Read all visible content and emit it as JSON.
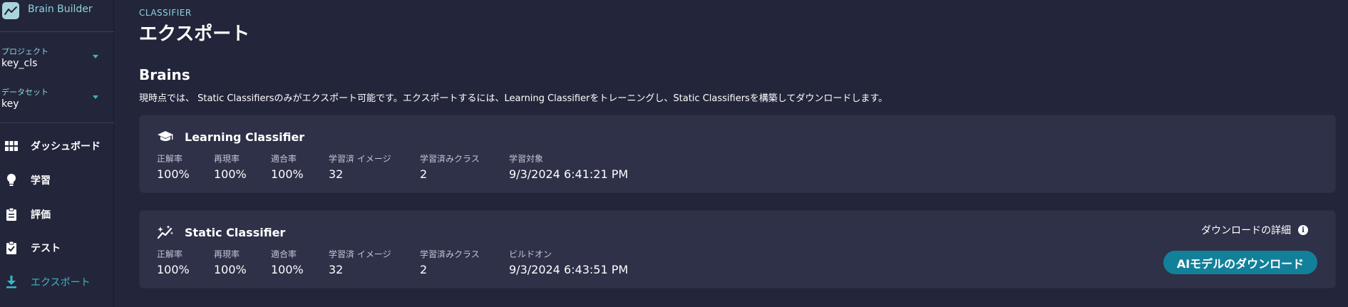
{
  "app": {
    "brand_name": "Brain Builder",
    "brand_icon": "trend-line-icon"
  },
  "sidebar": {
    "project": {
      "label": "プロジェクト",
      "value": "key_cls"
    },
    "dataset": {
      "label": "データセット",
      "value": "key"
    },
    "items": [
      {
        "label": "ダッシュボード",
        "icon": "grid-icon",
        "active": false
      },
      {
        "label": "学習",
        "icon": "lightbulb-icon",
        "active": false
      },
      {
        "label": "評価",
        "icon": "clipboard-icon",
        "active": false
      },
      {
        "label": "テスト",
        "icon": "clipboard-check-icon",
        "active": false
      },
      {
        "label": "エクスポート",
        "icon": "download-icon",
        "active": true
      }
    ]
  },
  "header": {
    "eyebrow": "CLASSIFIER",
    "title": "エクスポート"
  },
  "brains": {
    "title": "Brains",
    "description": "現時点では、 Static Classifiersのみがエクスポート可能です。エクスポートするには、Learning Classifierをトレーニングし、Static Classifiersを構築してダウンロードします。",
    "learning": {
      "title": "Learning Classifier",
      "icon": "graduation-cap-icon",
      "metrics": [
        {
          "label": "正解率",
          "value": "100%"
        },
        {
          "label": "再現率",
          "value": "100%"
        },
        {
          "label": "適合率",
          "value": "100%"
        },
        {
          "label": "学習済 イメージ",
          "value": "32"
        },
        {
          "label": "学習済みクラス",
          "value": "2"
        },
        {
          "label": "学習対象",
          "value": "9/3/2024 6:41:21 PM"
        }
      ]
    },
    "static": {
      "title": "Static Classifier",
      "icon": "sparkle-wand-icon",
      "metrics": [
        {
          "label": "正解率",
          "value": "100%"
        },
        {
          "label": "再現率",
          "value": "100%"
        },
        {
          "label": "適合率",
          "value": "100%"
        },
        {
          "label": "学習済 イメージ",
          "value": "32"
        },
        {
          "label": "学習済みクラス",
          "value": "2"
        },
        {
          "label": "ビルドオン",
          "value": "9/3/2024 6:43:51 PM"
        }
      ],
      "download_details_label": "ダウンロードの詳細",
      "info_glyph": "i",
      "download_button_label": "AIモデルのダウンロード"
    }
  },
  "colors": {
    "background": "#23263a",
    "card": "#2e3148",
    "accent": "#3bb6c9",
    "button": "#13809a"
  }
}
